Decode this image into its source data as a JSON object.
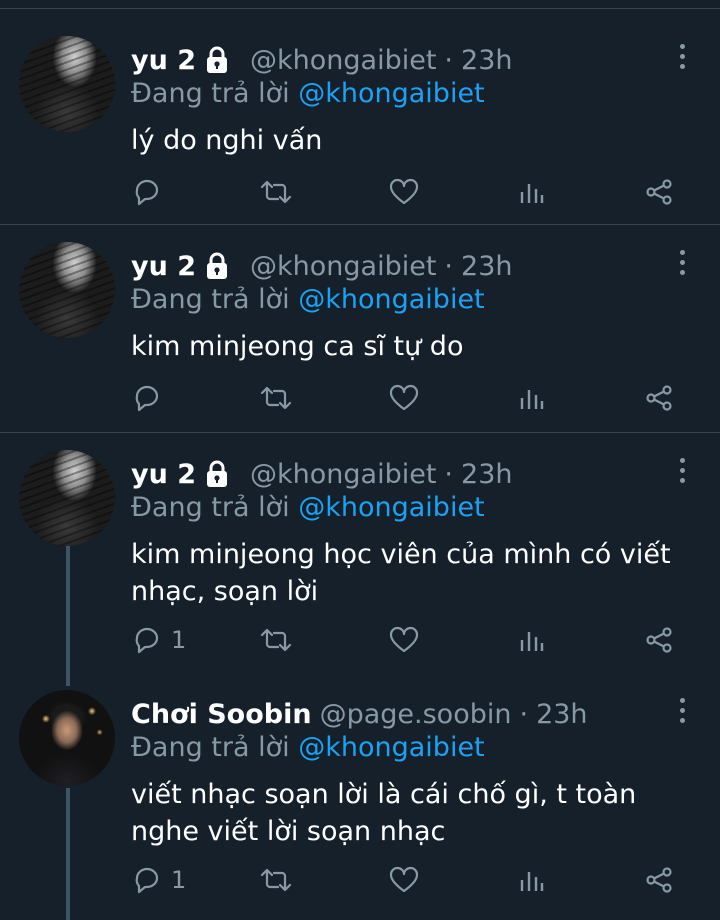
{
  "tweets": [
    {
      "author": "yu 2",
      "handle": "@khongaibiet",
      "dot": "·",
      "time": "23h",
      "reply_label": "Đang trả lời",
      "reply_to": "@khongaibiet",
      "text": "lý do nghi vấn",
      "reply_count": ""
    },
    {
      "author": "yu 2",
      "handle": "@khongaibiet",
      "dot": "·",
      "time": "23h",
      "reply_label": "Đang trả lời",
      "reply_to": "@khongaibiet",
      "text": "kim minjeong ca sĩ tự do",
      "reply_count": ""
    },
    {
      "author": "yu 2",
      "handle": "@khongaibiet",
      "dot": "·",
      "time": "23h",
      "reply_label": "Đang trả lời",
      "reply_to": "@khongaibiet",
      "text_lines": [
        "kim minjeong học viên của mình có viết",
        "nhạc, soạn lời"
      ],
      "reply_count": "1"
    },
    {
      "author": "Chơi Soobin",
      "handle": "@page.soobin",
      "dot": "·",
      "time": "23h",
      "reply_label": "Đang trả lời",
      "reply_to": "@khongaibiet",
      "text_lines": [
        "viết nhạc soạn lời là cái chố gì, t toàn",
        "nghe viết lời soạn nhạc"
      ],
      "reply_count": "1"
    }
  ],
  "icons": {
    "lock": "lock-icon",
    "more": "more-vertical-icon",
    "reply": "reply-icon",
    "retweet": "retweet-icon",
    "like": "heart-icon",
    "analytics": "analytics-icon",
    "share": "share-icon"
  },
  "colors": {
    "background": "#15202b",
    "divider": "#38444d",
    "muted": "#8899a6",
    "link": "#1da1f2",
    "thread": "#3d5466"
  }
}
